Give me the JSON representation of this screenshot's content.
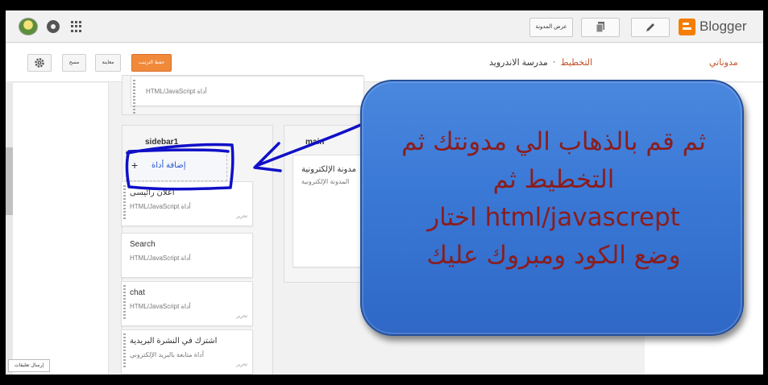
{
  "topbar": {
    "view_blog_label": "عرض المدونة",
    "brand": "Blogger"
  },
  "subbar": {
    "save_arrangement_label": "حفظ الترتيب",
    "preview_label": "معاينة",
    "clear_label": "مسح",
    "breadcrumb": [
      "مدرسة الاندرويد",
      "·",
      "التخطيط"
    ],
    "my_blogs_label": "مدوناتي"
  },
  "layout": {
    "top_gadget_sub": "HTML/JavaScript أداة",
    "sidebar_title": "sidebar1",
    "main_title": "main",
    "add_gadget_label": "إضافة أداة",
    "add_gadget_plus": "+",
    "sidebar_gadgets": [
      {
        "title": "اعلان رائيسى",
        "subtitle": "HTML/JavaScript أداة",
        "edit": "تحرير"
      },
      {
        "title": "Search",
        "subtitle": "HTML/JavaScript أداة",
        "edit": ""
      },
      {
        "title": "chat",
        "subtitle": "HTML/JavaScript أداة",
        "edit": "تحرير"
      },
      {
        "title": "اشترك في النشرة البريدية",
        "subtitle": "أداة متابعة بالبريد الإلكتروني",
        "edit": "تحرير"
      }
    ],
    "main_gadget": {
      "title": "مدونة الإلكترونية",
      "subtitle": "المدونة الإلكترونية"
    }
  },
  "leftnav": {
    "feedback_label": "إرسال تعليقات"
  },
  "callout": {
    "lines": [
      "ثم قم بالذهاب الي مدونتك ثم",
      "التخطيط ثم",
      "html/javascrept اختار",
      "وضع الكود ومبروك عليك"
    ],
    "colors": {
      "fill": "#3a78d6",
      "text": "#8a1d1d"
    }
  },
  "annotation": {
    "color": "#1010c8"
  }
}
